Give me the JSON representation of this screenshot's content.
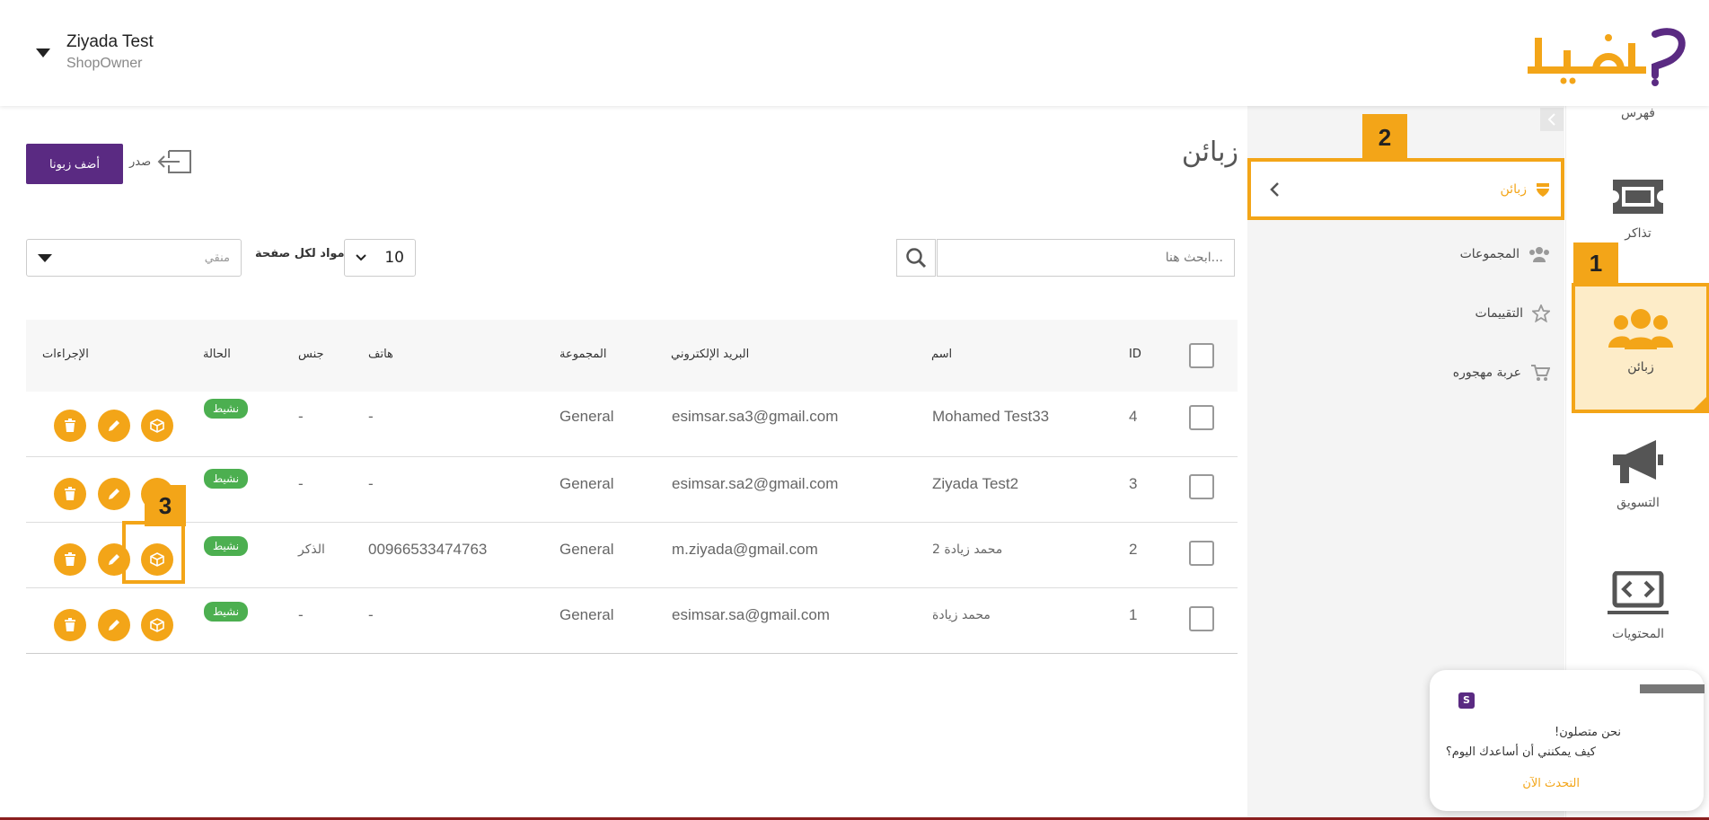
{
  "header": {
    "user_name": "Ziyada Test",
    "user_role": "ShopOwner",
    "logo_alt": "كليفا"
  },
  "rail": {
    "items": [
      {
        "label": "فهرس",
        "icon": "catalog-icon"
      },
      {
        "label": "تذاكر",
        "icon": "ticket-icon"
      },
      {
        "label": "زبائن",
        "icon": "users-icon"
      },
      {
        "label": "التسويق",
        "icon": "megaphone-icon"
      },
      {
        "label": "المحتويات",
        "icon": "laptop-code-icon"
      }
    ]
  },
  "subnav": {
    "items": [
      {
        "label": "زبائن",
        "icon": "shield-icon"
      },
      {
        "label": "المجموعات",
        "icon": "users-group-icon"
      },
      {
        "label": "التقييمات",
        "icon": "star-icon"
      },
      {
        "label": "عربة مهجوره",
        "icon": "cart-icon"
      }
    ]
  },
  "main": {
    "title": "زبائن",
    "add_label": "أضف زبونا",
    "export_label": "صدر",
    "search_placeholder": "...ابحث هنا",
    "per_page_value": "10",
    "per_page_label": "مواد لكل صفحة",
    "filter_placeholder": "منقي"
  },
  "table": {
    "headers": {
      "id": "ID",
      "name": "اسم",
      "email": "البريد الإلكتروني",
      "group": "المجموعة",
      "phone": "هاتف",
      "gender": "جنس",
      "status": "الحالة",
      "actions": "الإجراءات"
    },
    "rows": [
      {
        "id": "4",
        "name": "Mohamed Test33",
        "email": "esimsar.sa3@gmail.com",
        "group": "General",
        "phone": "-",
        "gender": "-",
        "status": "نشيط"
      },
      {
        "id": "3",
        "name": "Ziyada Test2",
        "email": "esimsar.sa2@gmail.com",
        "group": "General",
        "phone": "-",
        "gender": "-",
        "status": "نشيط"
      },
      {
        "id": "2",
        "name": "محمد زيادة 2",
        "email": "m.ziyada@gmail.com",
        "group": "General",
        "phone": "00966533474763",
        "gender": "الذكر",
        "status": "نشيط"
      },
      {
        "id": "1",
        "name": "محمد زيادة",
        "email": "esimsar.sa@gmail.com",
        "group": "General",
        "phone": "-",
        "gender": "-",
        "status": "نشيط"
      }
    ]
  },
  "markers": {
    "m1": "1",
    "m2": "2",
    "m3": "3"
  },
  "chat": {
    "line1": "!نحن متصلون",
    "line2": "كيف يمكنني أن أساعدك اليوم؟",
    "link": "التحدث الآن"
  },
  "colors": {
    "accent": "#f3a518",
    "brand": "#5a2a82",
    "active": "#4caf50"
  }
}
